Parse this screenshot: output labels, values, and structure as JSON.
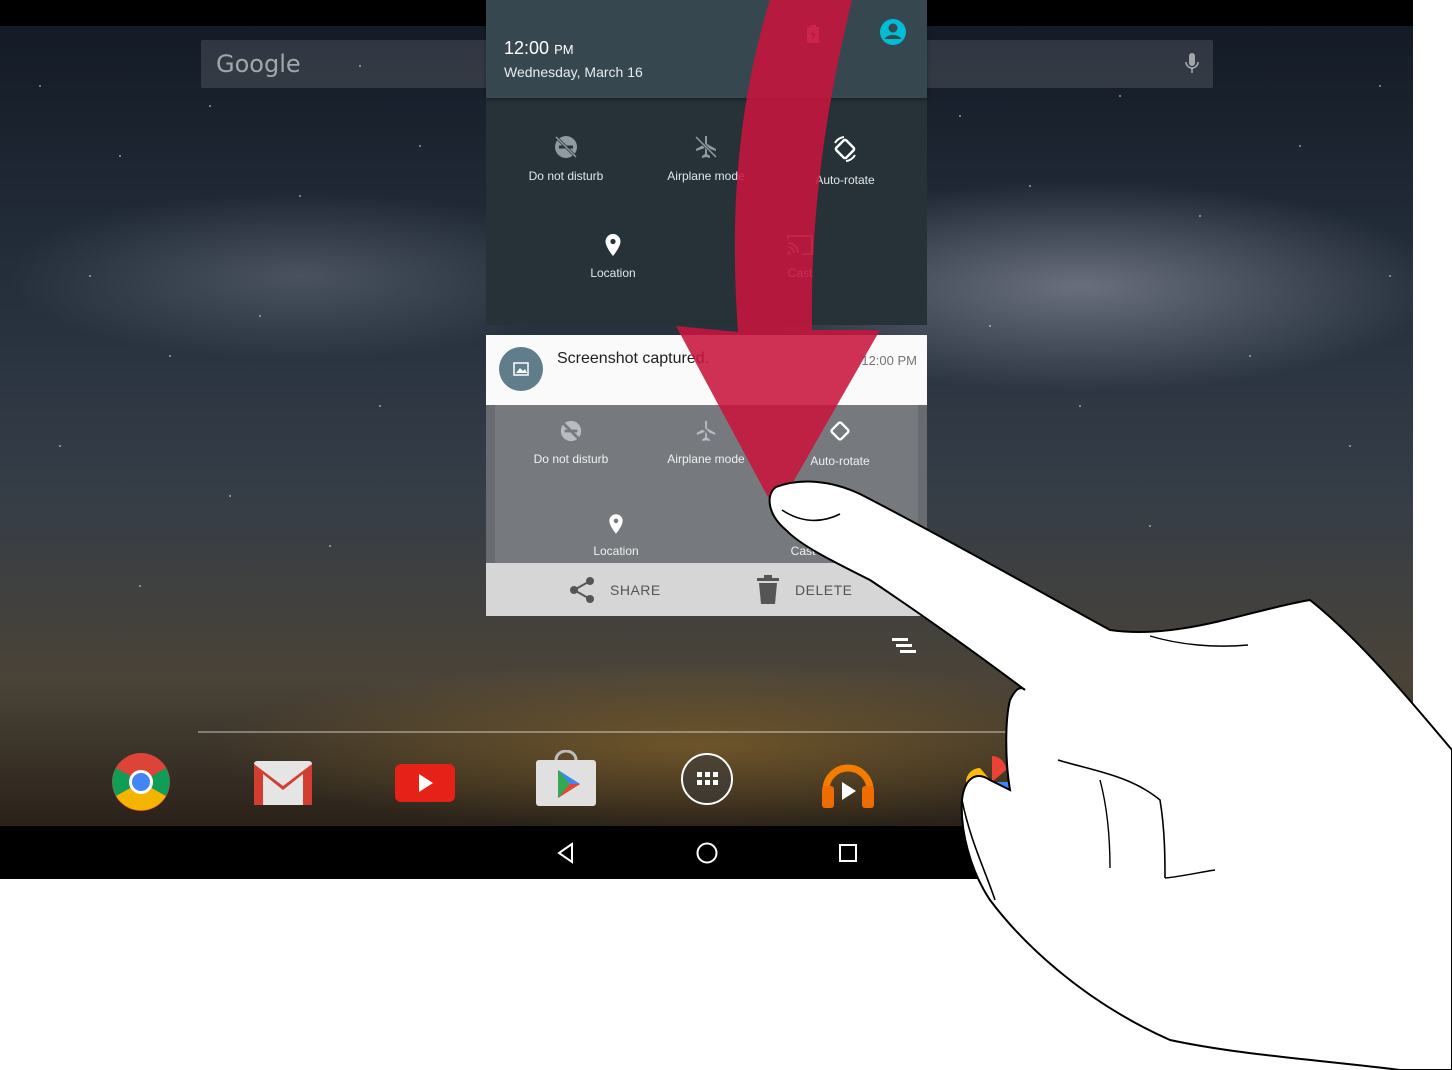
{
  "search": {
    "logo": "Google",
    "mic_icon": "mic-icon"
  },
  "shade": {
    "time": "12:00",
    "ampm": "PM",
    "date": "Wednesday, March 16",
    "tiles": [
      {
        "label": "Do not disturb",
        "icon": "do-not-disturb-icon"
      },
      {
        "label": "Airplane mode",
        "icon": "airplane-icon"
      },
      {
        "label": "Auto-rotate",
        "icon": "auto-rotate-icon"
      },
      {
        "label": "Location",
        "icon": "location-icon"
      },
      {
        "label": "Cast",
        "icon": "cast-icon"
      }
    ]
  },
  "notification": {
    "title": "Screenshot captured.",
    "time": "12:00 PM",
    "preview_tiles": [
      {
        "label": "Do not disturb"
      },
      {
        "label": "Airplane mode"
      },
      {
        "label": "Auto-rotate"
      },
      {
        "label": "Location"
      },
      {
        "label": "Cast"
      }
    ],
    "actions": {
      "share": "SHARE",
      "delete": "DELETE"
    }
  },
  "dock": {
    "apps": [
      "chrome-icon",
      "gmail-icon",
      "youtube-icon",
      "play-store-icon",
      "app-drawer-icon",
      "play-music-icon",
      "photos-icon"
    ]
  },
  "colors": {
    "arrow": "#c8143c",
    "shade_bg": "#263238",
    "header_bg": "#37474f",
    "accent_avatar": "#00bcd4"
  }
}
